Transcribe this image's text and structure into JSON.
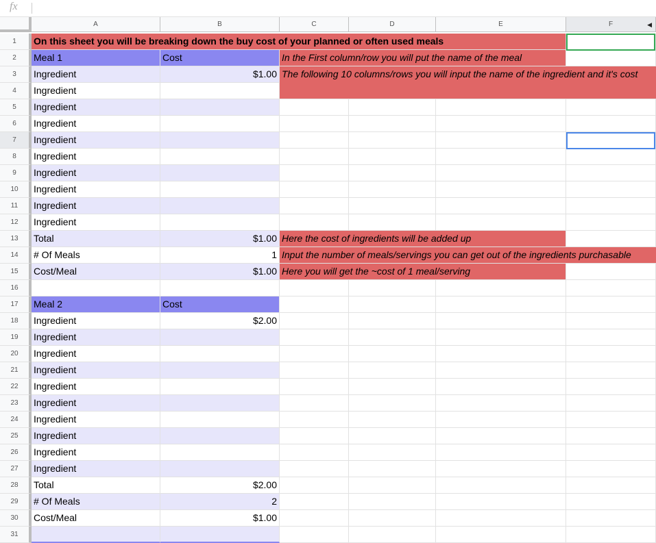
{
  "formula_bar": {
    "icon": "fx",
    "value": ""
  },
  "columns": [
    "A",
    "B",
    "C",
    "D",
    "E",
    "F"
  ],
  "rows": [
    "1",
    "2",
    "3",
    "4",
    "5",
    "6",
    "7",
    "8",
    "9",
    "10",
    "11",
    "12",
    "13",
    "14",
    "15",
    "16",
    "17",
    "18",
    "19",
    "20",
    "21",
    "22",
    "23",
    "24",
    "25",
    "26",
    "27",
    "28",
    "29",
    "30",
    "31"
  ],
  "sheet": {
    "title": "On this sheet you will be breaking down the buy cost of your planned or often used meals",
    "meal1": {
      "name": "Meal 1",
      "cost_header": "Cost",
      "ingredient_label": "Ingredient",
      "first_cost": "$1.00",
      "total_label": "Total",
      "total": "$1.00",
      "meals_label": "# Of Meals",
      "meals": "1",
      "costmeal_label": "Cost/Meal",
      "costmeal": "$1.00"
    },
    "meal2": {
      "name": "Meal 2",
      "cost_header": "Cost",
      "ingredient_label": "Ingredient",
      "first_cost": "$2.00",
      "total_label": "Total",
      "total": "$2.00",
      "meals_label": "# Of Meals",
      "meals": "2",
      "costmeal_label": "Cost/Meal",
      "costmeal": "$1.00"
    },
    "notes": {
      "row2": "In the First column/row you will put the name of the meal",
      "row3": "The following 10 columns/rows you will input the name of the ingredient and it's cost",
      "row13": "Here the cost of ingredients will be added up",
      "row14": "Input the number of meals/servings you can get out of the ingredients purchasable",
      "row15": "Here you will get the ~cost of 1 meal/serving"
    }
  },
  "colors": {
    "header_blue": "#8a87f0",
    "lavender": "#e7e6fb",
    "note_red": "#e06666"
  }
}
